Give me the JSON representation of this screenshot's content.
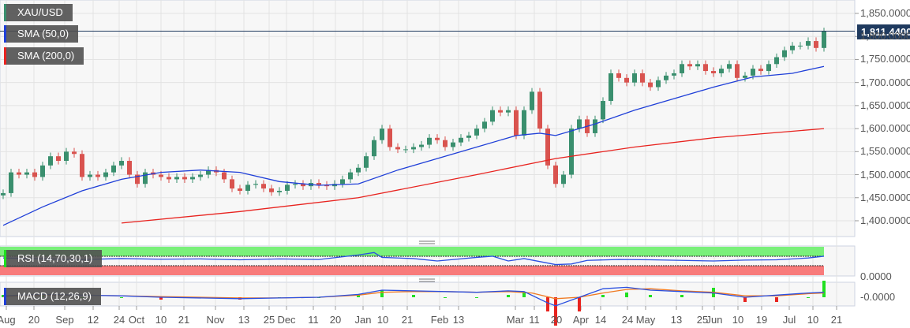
{
  "legend": {
    "symbol": "XAU/USD",
    "sma50": "SMA (50,0)",
    "sma200": "SMA (200,0)",
    "rsi": "RSI (14,70,30,1)",
    "macd": "MACD (12,26,9)"
  },
  "colors": {
    "up": "#3a8f6e",
    "down": "#d9534f",
    "sma50": "#1f3fd8",
    "sma200": "#e8231f",
    "rsi_over": "#7af07a",
    "rsi_under": "#f87b7b",
    "macd": "#2a4fe0",
    "signal": "#f07a22"
  },
  "current_price": "1,811.4400",
  "rsi_axis_label": "0.0000",
  "macd_axis_label": "-0.0000",
  "chart_data": {
    "type": "candlestick",
    "title": "XAU/USD",
    "ylim": [
      1350,
      1875
    ],
    "y_ticks": [
      "1,850.0000",
      "1,800.0000",
      "1,750.0000",
      "1,700.0000",
      "1,650.0000",
      "1,600.0000",
      "1,550.0000",
      "1,500.0000",
      "1,450.0000",
      "1,400.0000"
    ],
    "y_tick_values": [
      1850,
      1800,
      1750,
      1700,
      1650,
      1600,
      1550,
      1500,
      1450,
      1400
    ],
    "x_ticks": [
      "Aug",
      "20",
      "Sep",
      "12",
      "24",
      "Oct",
      "10",
      "21",
      "Nov",
      "13",
      "25",
      "Dec",
      "11",
      "20",
      "Jan",
      "10",
      "21",
      "Feb",
      "13",
      "Mar",
      "11",
      "20",
      "Apr",
      "14",
      "24",
      "May",
      "13",
      "25",
      "Jun",
      "10",
      "19",
      "Jul",
      "10",
      "21"
    ],
    "x_tick_index": [
      0.4,
      3.9,
      7.8,
      11.4,
      14.7,
      16.9,
      20,
      22.9,
      26.9,
      30.5,
      33.7,
      35.9,
      39.3,
      42.1,
      45.6,
      48.1,
      51.2,
      55.3,
      57.7,
      64.9,
      67.3,
      70.1,
      73.2,
      75.7,
      79.1,
      81.4,
      85.3,
      88.6,
      90.1,
      93.1,
      96.1,
      99.6,
      102.6,
      105.6
    ],
    "closes": [
      1460,
      1505,
      1500,
      1505,
      1495,
      1520,
      1540,
      1530,
      1550,
      1545,
      1495,
      1500,
      1495,
      1505,
      1520,
      1530,
      1500,
      1480,
      1505,
      1500,
      1495,
      1490,
      1495,
      1490,
      1495,
      1500,
      1510,
      1505,
      1490,
      1470,
      1465,
      1478,
      1480,
      1470,
      1462,
      1465,
      1478,
      1480,
      1475,
      1482,
      1478,
      1475,
      1480,
      1490,
      1505,
      1515,
      1540,
      1575,
      1600,
      1560,
      1555,
      1555,
      1560,
      1565,
      1580,
      1575,
      1560,
      1570,
      1580,
      1585,
      1600,
      1615,
      1640,
      1635,
      1640,
      1585,
      1640,
      1680,
      1600,
      1520,
      1480,
      1500,
      1600,
      1620,
      1590,
      1620,
      1660,
      1720,
      1710,
      1700,
      1720,
      1700,
      1690,
      1705,
      1715,
      1720,
      1740,
      1735,
      1740,
      1725,
      1720,
      1730,
      1740,
      1710,
      1715,
      1730,
      1725,
      1740,
      1755,
      1770,
      1780,
      1780,
      1790,
      1775,
      1811
    ],
    "sma50": [
      [
        0,
        1390
      ],
      [
        5,
        1430
      ],
      [
        10,
        1465
      ],
      [
        15,
        1490
      ],
      [
        20,
        1505
      ],
      [
        25,
        1510
      ],
      [
        30,
        1505
      ],
      [
        35,
        1485
      ],
      [
        40,
        1477
      ],
      [
        45,
        1480
      ],
      [
        50,
        1510
      ],
      [
        55,
        1535
      ],
      [
        60,
        1560
      ],
      [
        65,
        1585
      ],
      [
        68,
        1590
      ],
      [
        70,
        1585
      ],
      [
        75,
        1610
      ],
      [
        80,
        1640
      ],
      [
        85,
        1665
      ],
      [
        90,
        1690
      ],
      [
        95,
        1712
      ],
      [
        100,
        1720
      ],
      [
        104,
        1735
      ]
    ],
    "sma200": [
      [
        15,
        1395
      ],
      [
        30,
        1420
      ],
      [
        45,
        1450
      ],
      [
        60,
        1500
      ],
      [
        70,
        1535
      ],
      [
        80,
        1560
      ],
      [
        90,
        1580
      ],
      [
        104,
        1600
      ]
    ],
    "rsi": [
      [
        0,
        60
      ],
      [
        3,
        58
      ],
      [
        6,
        57
      ],
      [
        10,
        55
      ],
      [
        15,
        58
      ],
      [
        20,
        56
      ],
      [
        25,
        57
      ],
      [
        30,
        54
      ],
      [
        35,
        57
      ],
      [
        40,
        55
      ],
      [
        45,
        70
      ],
      [
        47,
        78
      ],
      [
        48,
        62
      ],
      [
        52,
        58
      ],
      [
        55,
        50
      ],
      [
        60,
        62
      ],
      [
        62,
        66
      ],
      [
        64,
        50
      ],
      [
        66,
        58
      ],
      [
        70,
        38
      ],
      [
        72,
        40
      ],
      [
        74,
        52
      ],
      [
        78,
        55
      ],
      [
        82,
        54
      ],
      [
        86,
        52
      ],
      [
        90,
        50
      ],
      [
        94,
        53
      ],
      [
        98,
        54
      ],
      [
        102,
        60
      ],
      [
        104,
        66
      ]
    ],
    "macd": [
      [
        0,
        2
      ],
      [
        5,
        4
      ],
      [
        10,
        3
      ],
      [
        15,
        2
      ],
      [
        20,
        0
      ],
      [
        30,
        -2
      ],
      [
        35,
        -1
      ],
      [
        40,
        0
      ],
      [
        45,
        4
      ],
      [
        48,
        10
      ],
      [
        52,
        9
      ],
      [
        56,
        8
      ],
      [
        60,
        7
      ],
      [
        64,
        9
      ],
      [
        66,
        8
      ],
      [
        69,
        -8
      ],
      [
        70,
        -12
      ],
      [
        73,
        0
      ],
      [
        76,
        12
      ],
      [
        79,
        14
      ],
      [
        82,
        10
      ],
      [
        86,
        8
      ],
      [
        90,
        6
      ],
      [
        94,
        0
      ],
      [
        98,
        3
      ],
      [
        102,
        6
      ],
      [
        104,
        7
      ]
    ],
    "signal": [
      [
        0,
        1
      ],
      [
        5,
        3
      ],
      [
        10,
        3
      ],
      [
        15,
        2
      ],
      [
        20,
        1
      ],
      [
        30,
        -1
      ],
      [
        35,
        -1
      ],
      [
        40,
        0
      ],
      [
        45,
        3
      ],
      [
        48,
        7
      ],
      [
        52,
        8
      ],
      [
        56,
        8
      ],
      [
        60,
        7
      ],
      [
        64,
        8
      ],
      [
        67,
        6
      ],
      [
        70,
        -2
      ],
      [
        73,
        0
      ],
      [
        76,
        6
      ],
      [
        79,
        11
      ],
      [
        82,
        12
      ],
      [
        86,
        9
      ],
      [
        90,
        7
      ],
      [
        94,
        2
      ],
      [
        98,
        2
      ],
      [
        102,
        5
      ],
      [
        104,
        6
      ]
    ]
  }
}
